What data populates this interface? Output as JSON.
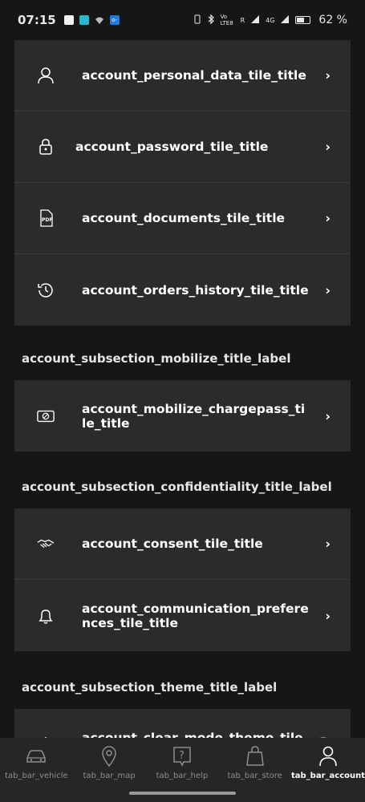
{
  "status_bar": {
    "time": "07:15",
    "network_label": "Vo LTE8",
    "network_r": "R",
    "signal_label": "4G",
    "battery_percent": "62 %",
    "battery_level": 0.62
  },
  "groups": [
    {
      "tiles": [
        {
          "title": "account_personal_data_tile_title",
          "icon": "person-icon"
        },
        {
          "title": "account_password_tile_title",
          "icon": "lock-icon"
        },
        {
          "title": "account_documents_tile_title",
          "icon": "pdf-icon"
        },
        {
          "title": "account_orders_history_tile_title",
          "icon": "history-icon"
        }
      ]
    }
  ],
  "sections": [
    {
      "label": "account_subsection_mobilize_title_label",
      "tiles": [
        {
          "title": "account_mobilize_chargepass_tile_title",
          "icon": "chargepass-icon"
        }
      ]
    },
    {
      "label": "account_subsection_confidentiality_title_label",
      "tiles": [
        {
          "title": "account_consent_tile_title",
          "icon": "handshake-icon"
        },
        {
          "title": "account_communication_preferences_tile_title",
          "icon": "bell-icon"
        }
      ]
    },
    {
      "label": "account_subsection_theme_title_label",
      "tiles": [
        {
          "title": "account_clear_mode_theme_tile_title",
          "icon": "sun-icon"
        }
      ]
    }
  ],
  "tab_bar": {
    "tabs": [
      {
        "label": "tab_bar_vehicle",
        "icon": "car-icon",
        "active": false
      },
      {
        "label": "tab_bar_map",
        "icon": "map-pin-icon",
        "active": false
      },
      {
        "label": "tab_bar_help",
        "icon": "help-icon",
        "active": false
      },
      {
        "label": "tab_bar_store",
        "icon": "shopping-bag-icon",
        "active": false
      },
      {
        "label": "tab_bar_account",
        "icon": "account-icon",
        "active": true
      }
    ]
  }
}
